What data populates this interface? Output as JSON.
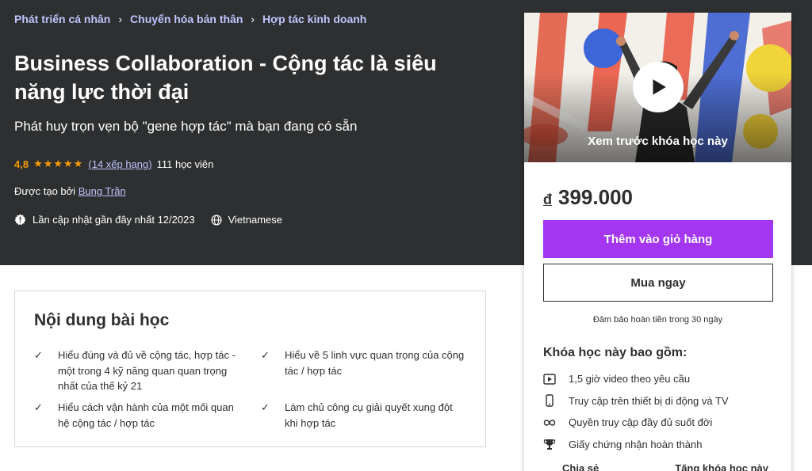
{
  "breadcrumb": [
    "Phát triển cá nhân",
    "Chuyển hóa bản thân",
    "Hợp tác kinh doanh"
  ],
  "course": {
    "title": "Business Collaboration - Cộng tác là siêu năng lực thời đại",
    "subtitle": "Phát huy trọn vẹn bộ \"gene hợp tác\" mà bạn đang có sẵn",
    "rating": "4,8",
    "rating_count": "(14 xếp hạng)",
    "students": "111 học viên",
    "creator_prefix": "Được tạo bởi",
    "creator_name": "Bung Trần",
    "updated": "Lần cập nhật gần đây nhất 12/2023",
    "language": "Vietnamese"
  },
  "content": {
    "heading": "Nội dung bài học",
    "items": [
      "Hiểu đúng và đủ về cộng tác, hợp tác - một trong 4 kỹ năng quan quan trọng nhất của thế kỷ 21",
      "Hiểu về 5 linh vực quan trọng của cộng tác / hợp tác",
      "Hiểu cách vận hành của một mối quan hệ cộng tác / hợp tác",
      "Làm chủ công cụ giải quyết xung đột khi hợp tác"
    ]
  },
  "sidebar": {
    "preview_label": "Xem trước khóa học này",
    "currency": "đ",
    "price": "399.000",
    "add_to_cart": "Thêm vào giỏ hàng",
    "buy_now": "Mua ngay",
    "guarantee": "Đảm bảo hoàn tiền trong 30 ngày",
    "includes_title": "Khóa học này bao gồm:",
    "includes": [
      {
        "icon": "video-icon",
        "text": "1,5 giờ video theo yêu cầu"
      },
      {
        "icon": "mobile-tv-icon",
        "text": "Truy cập trên thiết bị di động và TV"
      },
      {
        "icon": "infinity-icon",
        "text": "Quyền truy cập đầy đủ suốt đời"
      },
      {
        "icon": "trophy-icon",
        "text": "Giấy chứng nhận hoàn thành"
      }
    ],
    "share": "Chia sẻ",
    "gift": "Tặng khóa học này"
  },
  "colors": {
    "hero_bg": "#2d2f31",
    "link_purple": "#c0c4fc",
    "star_orange": "#f69c08",
    "cta_purple": "#a435f0"
  }
}
